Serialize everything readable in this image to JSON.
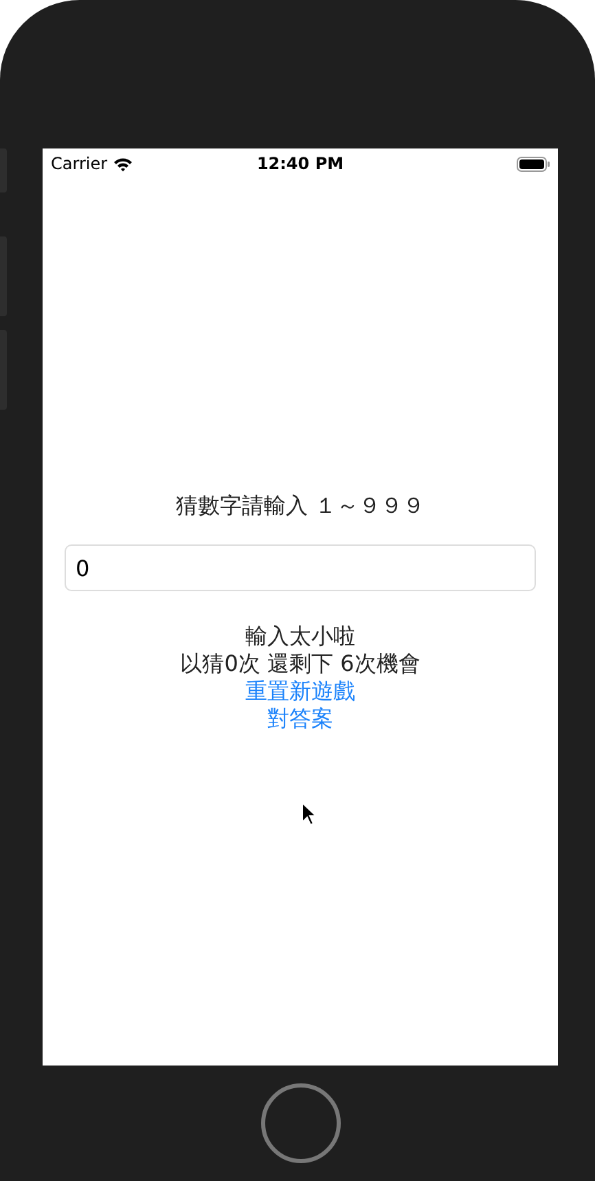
{
  "status_bar": {
    "carrier": "Carrier",
    "time": "12:40 PM"
  },
  "prompt": "猜數字請輸入 １～９９９",
  "guess_field": {
    "value": "0"
  },
  "result": "輸入太小啦",
  "attempts": "以猜0次 還剩下 6次機會",
  "links": [
    {
      "label": "重置新遊戲"
    },
    {
      "label": "對答案"
    }
  ]
}
